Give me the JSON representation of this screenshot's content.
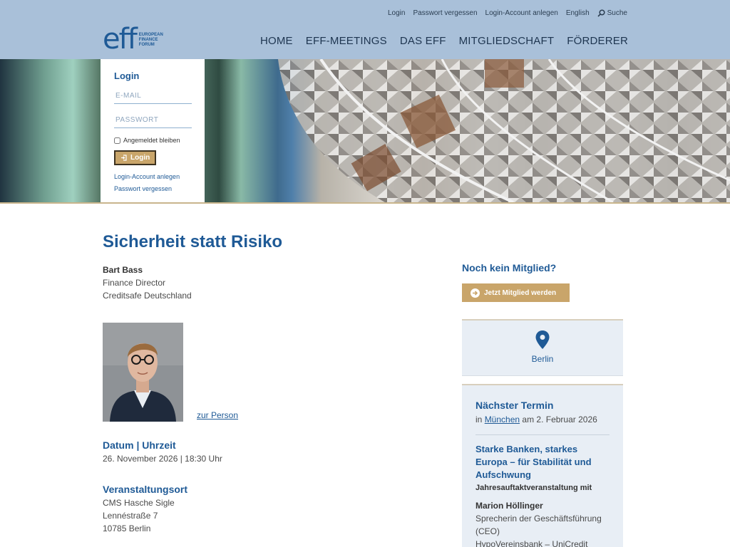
{
  "top_nav": [
    "Login",
    "Passwort vergessen",
    "Login-Account anlegen",
    "English"
  ],
  "search_label": "Suche",
  "logo": {
    "mark": "eff",
    "line1": "EUROPEAN",
    "line2": "FINANCE",
    "line3": "FORUM"
  },
  "main_nav": [
    "HOME",
    "EFF-MEETINGS",
    "DAS EFF",
    "MITGLIEDSCHAFT",
    "FÖRDERER"
  ],
  "login": {
    "title": "Login",
    "email_placeholder": "E-MAIL",
    "password_placeholder": "PASSWORT",
    "remember_label": "Angemeldet bleiben",
    "button_label": "Login",
    "create_account": "Login-Account anlegen",
    "forgot_password": "Passwort vergessen"
  },
  "page_title": "Sicherheit statt Risiko",
  "speaker": {
    "name": "Bart Bass",
    "role": "Finance Director",
    "company": "Creditsafe Deutschland",
    "profile_link": "zur Person"
  },
  "date_section": {
    "heading": "Datum | Uhrzeit",
    "value": "26. November 2026 | 18:30 Uhr"
  },
  "venue_section": {
    "heading": "Veranstaltungsort",
    "name": "CMS Hasche Sigle",
    "street": "Lennéstraße 7",
    "city": "10785 Berlin"
  },
  "sidebar": {
    "join_title": "Noch kein Mitglied?",
    "join_button": "Jetzt Mitglied werden",
    "city": "Berlin",
    "next_title": "Nächster Termin",
    "next_prefix": "in",
    "next_city": "München",
    "next_suffix": "am 2. Februar 2026",
    "event_title": "Starke Banken, starkes Europa – für Stabilität und Aufschwung",
    "event_subtitle": "Jahresauftaktveranstaltung mit",
    "event_person": "Marion Höllinger",
    "event_role": "Sprecherin der Geschäftsführung (CEO)",
    "event_company": "HypoVereinsbank – UniCredit Bank"
  },
  "colors": {
    "header_bg": "#a9c0d9",
    "brand_blue": "#1f5a96",
    "gold": "#c9a56a",
    "sidebar_bg": "#e8eef5"
  }
}
